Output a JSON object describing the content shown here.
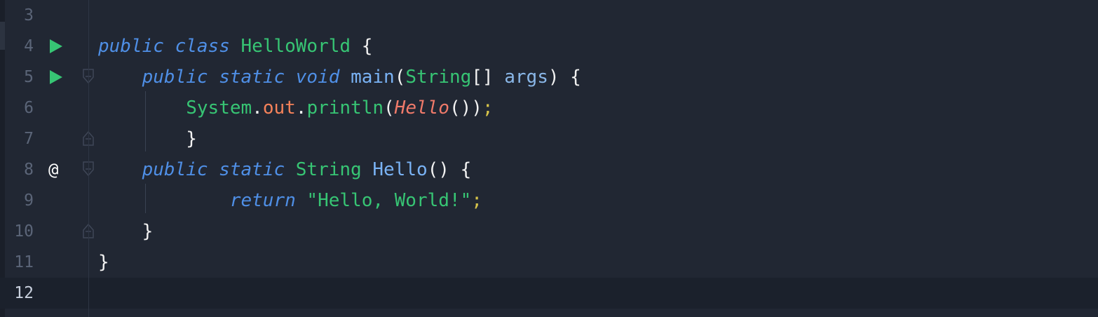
{
  "editor": {
    "colors": {
      "background": "#212733",
      "current_line": "#1b212c",
      "line_number": "#5b6578",
      "keyword": "#4f8fe6",
      "class_name": "#37c574",
      "method": "#7ab3f5",
      "field": "#f5825a",
      "string": "#37c574",
      "run_icon": "#37c574"
    },
    "current_line": 12,
    "lines": [
      {
        "num": "3",
        "tokens": []
      },
      {
        "num": "4",
        "gutter": "run-icon",
        "tokens": [
          {
            "t": "public",
            "c": "kw"
          },
          {
            "t": " "
          },
          {
            "t": "class",
            "c": "kw"
          },
          {
            "t": " "
          },
          {
            "t": "HelloWorld",
            "c": "cls"
          },
          {
            "t": " {",
            "c": "pun"
          }
        ]
      },
      {
        "num": "5",
        "gutter": "run-icon",
        "fold": "open",
        "tokens": [
          {
            "t": "    "
          },
          {
            "t": "public",
            "c": "kw"
          },
          {
            "t": " "
          },
          {
            "t": "static",
            "c": "kw"
          },
          {
            "t": " "
          },
          {
            "t": "void",
            "c": "kw"
          },
          {
            "t": " "
          },
          {
            "t": "main",
            "c": "fn"
          },
          {
            "t": "(",
            "c": "pun"
          },
          {
            "t": "String",
            "c": "cls"
          },
          {
            "t": "[] ",
            "c": "pun"
          },
          {
            "t": "args",
            "c": "var"
          },
          {
            "t": ") {",
            "c": "pun"
          }
        ]
      },
      {
        "num": "6",
        "tokens": [
          {
            "t": "        "
          },
          {
            "t": "System",
            "c": "cls"
          },
          {
            "t": ".",
            "c": "pun"
          },
          {
            "t": "out",
            "c": "fld"
          },
          {
            "t": ".",
            "c": "pun"
          },
          {
            "t": "println",
            "c": "cls"
          },
          {
            "t": "(",
            "c": "pun"
          },
          {
            "t": "Hello",
            "c": "call"
          },
          {
            "t": "())",
            "c": "pun"
          },
          {
            "t": ";",
            "c": "semi"
          }
        ]
      },
      {
        "num": "7",
        "fold": "close",
        "tokens": [
          {
            "t": "        "
          },
          {
            "t": "}",
            "c": "pun"
          }
        ]
      },
      {
        "num": "8",
        "gutter": "@",
        "fold": "open",
        "tokens": [
          {
            "t": "    "
          },
          {
            "t": "public",
            "c": "kw"
          },
          {
            "t": " "
          },
          {
            "t": "static",
            "c": "kw"
          },
          {
            "t": " "
          },
          {
            "t": "String",
            "c": "cls"
          },
          {
            "t": " "
          },
          {
            "t": "Hello",
            "c": "fn"
          },
          {
            "t": "() {",
            "c": "pun"
          }
        ]
      },
      {
        "num": "9",
        "tokens": [
          {
            "t": "            "
          },
          {
            "t": "return",
            "c": "kw"
          },
          {
            "t": " "
          },
          {
            "t": "\"Hello, World!\"",
            "c": "str"
          },
          {
            "t": ";",
            "c": "semi"
          }
        ]
      },
      {
        "num": "10",
        "fold": "close",
        "tokens": [
          {
            "t": "    "
          },
          {
            "t": "}",
            "c": "pun"
          }
        ]
      },
      {
        "num": "11",
        "tokens": [
          {
            "t": "}",
            "c": "pun"
          }
        ]
      },
      {
        "num": "12",
        "tokens": []
      }
    ]
  }
}
